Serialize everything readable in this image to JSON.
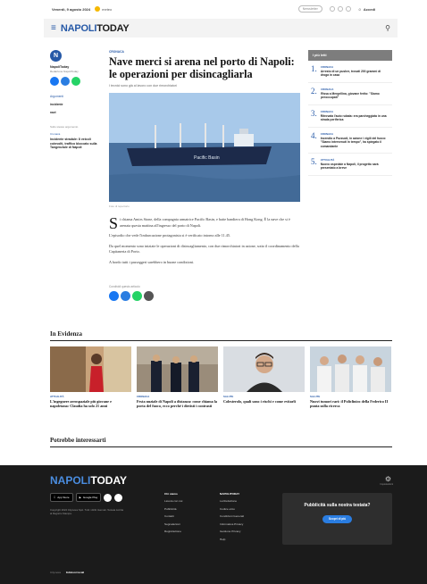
{
  "topbar": {
    "date": "Venerdì, 9 agosto 2024",
    "weather": "meteo",
    "newsletter": "Newsletter",
    "login": "Accedi"
  },
  "header": {
    "logo_part1": "NAPOLI",
    "logo_part2": "TODAY"
  },
  "left": {
    "logo_letter": "N",
    "author": "NapoliToday",
    "author_sub": "Redazione NapoliToday",
    "section_label": "Argomenti",
    "items": [
      "incidente",
      "navi"
    ],
    "small": "Sullo stesso argomento",
    "related_category": "Cronaca",
    "related_title": "Incidente stradale: 8 veicoli coinvolti, traffico bloccato sulla Tangenziale di Napoli"
  },
  "article": {
    "kicker": "CRONACA",
    "title": "Nave merci si arena nel porto di Napoli: le operazioni per disincagliarla",
    "subtitle": "I tecnici sono già al lavoro con due rimorchiatori",
    "ship_name": "Pacific Basin",
    "caption": "Foto di repertorio",
    "dropcap": "S",
    "paragraphs": [
      "i chiama Amirs Stone, della compagnia armatrice Pacific Basin, e batte bandiera di Hong Kong. È la nave che si è arenata questa mattina all'ingresso del porto di Napoli.",
      "L'episodio che vede l'imbarcazione protagonista si è verificato intorno alle 11.45.",
      "Da quel momento sono iniziate le operazioni di disincagliamento, con due rimorchiatori in azione, sotto il coordinamento della Capitaneria di Porto.",
      "A bordo tutti i passeggeri sarebbero in buone condizioni."
    ],
    "share_label": "Condividi questo articolo"
  },
  "right": {
    "header": "I più letti",
    "items": [
      {
        "num": "1.",
        "category": "CRONACA",
        "title": "Arresto di un pusher, trovati 200 grammi di droga in casa"
      },
      {
        "num": "2.",
        "category": "CRONACA",
        "title": "Rissa a Mergellina, giovane ferito: \"Siamo preoccupati\""
      },
      {
        "num": "3.",
        "category": "CRONACA",
        "title": "Ritrovata l'auto rubata: era parcheggiata in una strada periferica"
      },
      {
        "num": "4.",
        "category": "CRONACA",
        "title": "Incendio a Pozzuoli, in azione i vigili del fuoco: \"Siamo intervenuti in tempo\", ha spiegato il comandante"
      },
      {
        "num": "5.",
        "category": "ATTUALITÀ",
        "title": "Nuovo ospedale a Napoli, il progetto sarà presentato a breve"
      }
    ]
  },
  "evidenza": {
    "title": "In Evidenza",
    "cards": [
      {
        "category": "ATTUALITÀ",
        "title": "L'ingegnere aerospaziale più giovane e napoletana: Claudia ha solo 21 anni"
      },
      {
        "category": "CRONACA",
        "title": "Festa nuziale di Napoli a distanza: come chiama la porta del fuoco, ecco perché i dietisti i contrasti"
      },
      {
        "category": "SALUTE",
        "title": "Colesterolo, quali sono i rischi e come evitarli"
      },
      {
        "category": "SALUTE",
        "title": "Nuovi tumori rari: il Policlinico della Federico II punta sulla ricerca"
      }
    ]
  },
  "potrebbe": {
    "title": "Potrebbe interessarti"
  },
  "footer": {
    "logo_part1": "NAPOLI",
    "logo_part2": "TODAY",
    "app_store": "App Store",
    "google_play": "Google Play",
    "copyright": "Copyright 2024 Citynews SpA. Tutti i diritti riservati. Testata iscritta al Registro Stampa.",
    "settings_label": "Impostazioni",
    "col1": [
      "Chi siamo",
      "Lavora con noi",
      "Pubblicità",
      "Contatti",
      "Segnalazioni",
      "Registrazione"
    ],
    "col2": [
      "NAPOLITODAY",
      "La Redazione",
      "Codice etico",
      "Condizioni Generali",
      "Informativa Privacy",
      "Gestione Privacy",
      "Help"
    ],
    "promo_title": "Pubblicità sulla nostra testata?",
    "promo_button": "Scopri di più",
    "bottom_left": "Citynews",
    "bottom_right": "Edizioni locali"
  }
}
